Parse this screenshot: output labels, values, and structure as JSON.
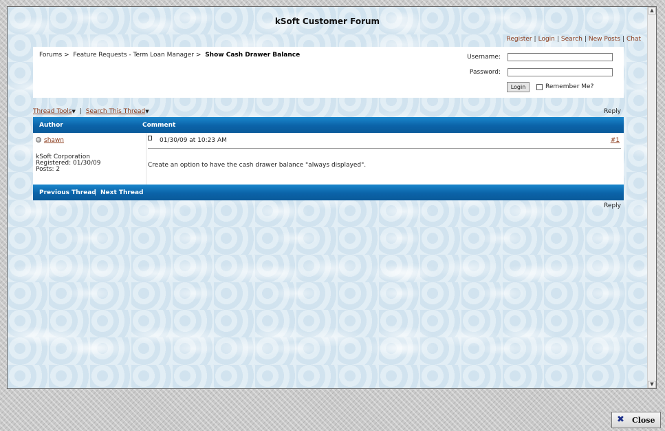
{
  "forum": {
    "title": "kSoft Customer Forum",
    "links": [
      "Register",
      "Login",
      "Search",
      "New Posts",
      "Chat"
    ],
    "separator": "|"
  },
  "breadcrumb": {
    "items": [
      "Forums",
      "Feature Requests - Term Loan Manager"
    ],
    "current": "Show Cash Drawer Balance",
    "arrow": ">"
  },
  "login": {
    "username_label": "Username:",
    "password_label": "Password:",
    "button_label": "Login",
    "remember_label": "Remember Me?"
  },
  "thread": {
    "tools_label": "Thread Tools",
    "search_label": "Search This Thread",
    "reply_label": "Reply",
    "author_header": "Author",
    "comment_header": "Comment",
    "prev_label": "Previous Thread",
    "next_label": "Next Thread"
  },
  "post": {
    "author": "shawn",
    "company": "kSoft Corporation",
    "registered": "Registered: 01/30/09",
    "posts": "Posts: 2",
    "date": "01/30/09 at 10:23 AM",
    "number": "#1",
    "body": "Create an option to have the cash drawer balance \"always displayed\"."
  },
  "dialog": {
    "close_label": "Close"
  },
  "colors": {
    "bar_blue": "#0b63a8",
    "link_brown": "#8a3a1a"
  }
}
